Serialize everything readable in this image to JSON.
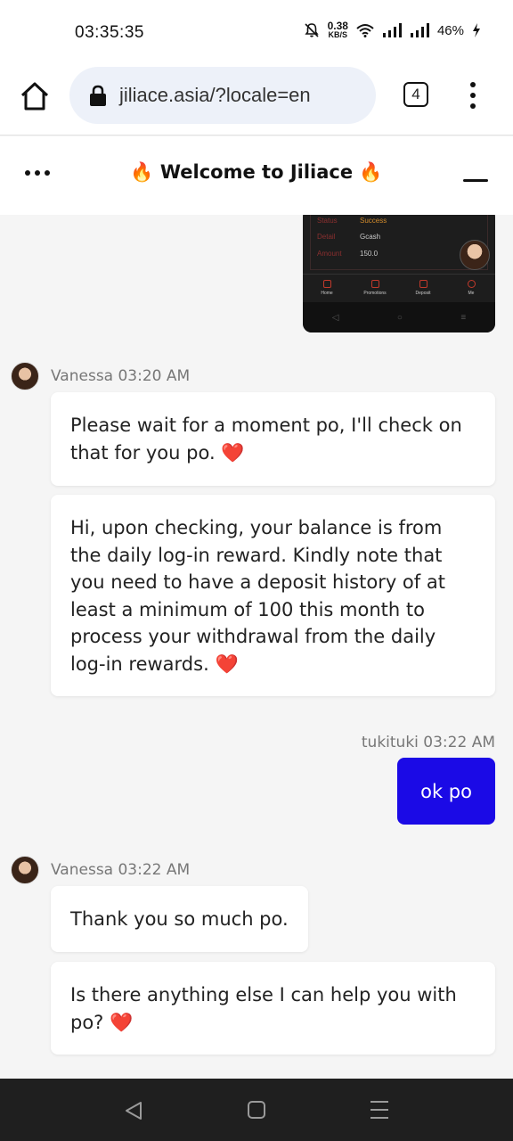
{
  "status_bar": {
    "time": "03:35:35",
    "net_speed_value": "0.38",
    "net_speed_unit": "KB/S",
    "battery": "46%"
  },
  "browser": {
    "url": "jiliace.asia/?locale=en",
    "tab_count": "4"
  },
  "chat_header": {
    "title": "🔥 Welcome to Jiliace 🔥"
  },
  "screenshot_preview": {
    "rows": [
      {
        "key": "Status",
        "value": "Success"
      },
      {
        "key": "Detail",
        "value": "Gcash"
      },
      {
        "key": "Amount",
        "value": "150.0"
      }
    ],
    "nav": [
      "Home",
      "Promotions",
      "Deposit",
      "Me"
    ]
  },
  "messages": {
    "m1": {
      "meta": "Vanessa 03:20 AM"
    },
    "b1": {
      "text": "Please wait for a moment po, I'll check on that for you po.",
      "emoji": "❤️"
    },
    "b2": {
      "text": "Hi, upon checking, your balance is from the daily log-in reward. Kindly note that you need to have a deposit history of at least a minimum of 100 this month to process your withdrawal from the daily log-in rewards.",
      "emoji": "❤️"
    },
    "me1": {
      "meta": "tukituki 03:22 AM",
      "text": "ok po"
    },
    "m2": {
      "meta": "Vanessa 03:22 AM"
    },
    "b3": {
      "text": "Thank you so much po."
    },
    "b4": {
      "text": "Is there anything else I can help you with po?",
      "emoji": "❤️"
    }
  },
  "colors": {
    "accent_user_bubble": "#1b0ae6",
    "heart": "#e02b2b"
  }
}
